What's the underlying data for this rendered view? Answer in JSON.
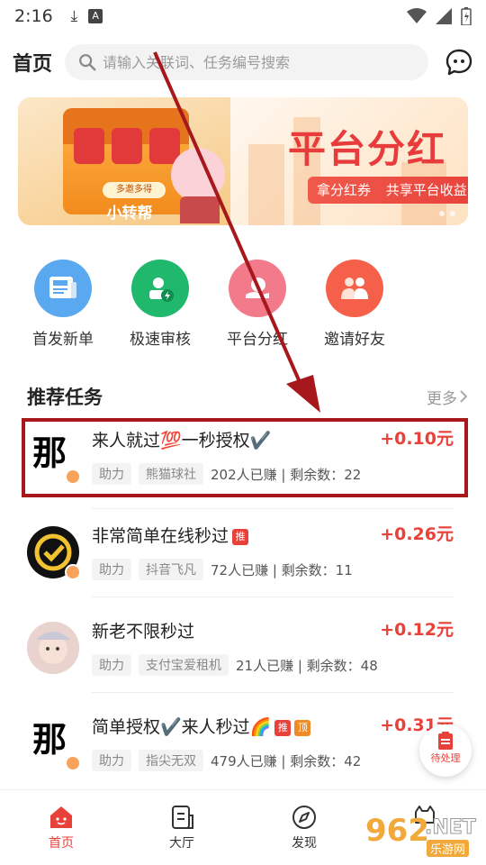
{
  "status_bar": {
    "time": "2:16"
  },
  "header": {
    "title": "首页",
    "search_placeholder": "请输入关联词、任务编号搜索"
  },
  "banner": {
    "left_tag": "多邀多得",
    "left_label": "小转帮",
    "title": "平台分红",
    "pill_left": "拿分红券",
    "pill_right": "共享平台收益"
  },
  "shortcuts": [
    {
      "label": "首发新单",
      "color": "#5aa9f0",
      "icon": "news-icon"
    },
    {
      "label": "极速审核",
      "color": "#1fb86c",
      "icon": "fast-review-icon"
    },
    {
      "label": "平台分红",
      "color": "#f27a8a",
      "icon": "dividend-icon"
    },
    {
      "label": "邀请好友",
      "color": "#f5604a",
      "icon": "invite-icon"
    }
  ],
  "section": {
    "title": "推荐任务",
    "more": "更多"
  },
  "tasks": [
    {
      "title": "来人就过💯一秒授权✔️",
      "price": "+0.10元",
      "tag1": "助力",
      "tag2": "熊猫球社",
      "stat": "202人已赚 | 剩余数：22",
      "badges": []
    },
    {
      "title": "非常简单在线秒过",
      "price": "+0.26元",
      "tag1": "助力",
      "tag2": "抖音飞凡",
      "stat": "72人已赚 | 剩余数：11",
      "badges": [
        "推"
      ]
    },
    {
      "title": "新老不限秒过",
      "price": "+0.12元",
      "tag1": "助力",
      "tag2": "支付宝爱租机",
      "stat": "21人已赚 | 剩余数：48",
      "badges": []
    },
    {
      "title": "简单授权✔️来人秒过🌈",
      "price": "+0.31元",
      "tag1": "助力",
      "tag2": "指尖无双",
      "stat": "479人已赚 | 剩余数：42",
      "badges": [
        "推",
        "顶"
      ]
    }
  ],
  "floating": {
    "pending": "待处理"
  },
  "tabbar": [
    {
      "label": "首页",
      "active": true
    },
    {
      "label": "大厅",
      "active": false
    },
    {
      "label": "发现",
      "active": false
    }
  ],
  "watermark": {
    "num": "962",
    "net": ".NET",
    "cn": "乐游网"
  },
  "colors": {
    "accent": "#e8413a",
    "highlight": "#a7181c"
  }
}
